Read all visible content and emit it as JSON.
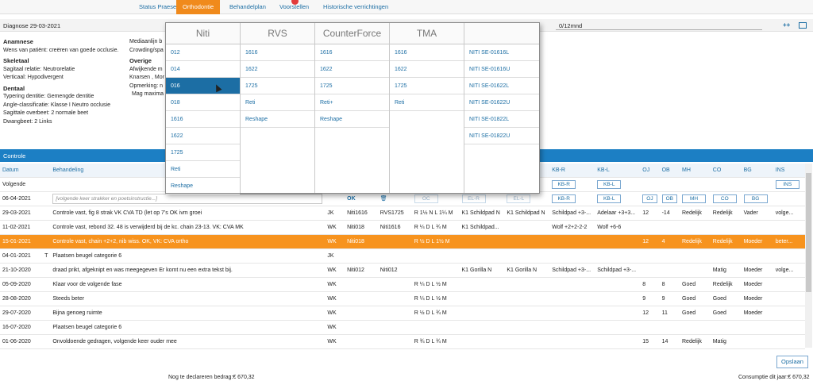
{
  "nav": {
    "tabs": [
      {
        "label": "Status Praesens"
      },
      {
        "label": "Orthodontie"
      },
      {
        "label": "Behandelplan"
      },
      {
        "label": "Voorstellen"
      },
      {
        "label": "Historische verrichtingen"
      }
    ]
  },
  "diagnosis": {
    "title": "Diagnose 29-03-2021",
    "months": "0/12mnd",
    "plus": "++"
  },
  "anamnese": {
    "heading": "Anamnese",
    "text": "Wens van patiënt: creëren van goede occlusie."
  },
  "skeletaal": {
    "heading": "Skeletaal",
    "lines": [
      "Sagitaal relatie: Neutrorelatie",
      "Verticaal: Hypodivergent"
    ]
  },
  "dentaal": {
    "heading": "Dentaal",
    "lines": [
      "Typering dentitie: Gemengde dentitie",
      "Angle-classificatie: Klasse I Neutro occlusie",
      "Sagittale overbeet: 2 normale beet",
      "Dwangbeet: 2 Links"
    ]
  },
  "middle_panel": {
    "lines": [
      "Mediaanlijn b",
      "Crowding/spa"
    ],
    "overige_heading": "Overige",
    "overige_lines": [
      "Afwijkende m",
      "Knarsen , Mor",
      "Opmerking: n",
      "Mag maxima"
    ]
  },
  "controle": {
    "title": "Controle",
    "columns": [
      "Datum",
      "Behandeling",
      "",
      "",
      "",
      "",
      "",
      "",
      "",
      "KB-R",
      "KB-L",
      "OJ",
      "OB",
      "MH",
      "CO",
      "BG",
      "INS"
    ],
    "volgende_label": "Volgende",
    "volgende_chips": [
      "KB-R",
      "KB-L",
      "INS"
    ],
    "input_row": {
      "date": "06-04-2021",
      "placeholder": "[volgende keer strakker en poetsinstructie...]",
      "ok": "OK",
      "chips": [
        "OC",
        "EL-R",
        "EL-L",
        "KB-R",
        "KB-L",
        "OJ",
        "OB",
        "MH",
        "CO",
        "BG"
      ]
    },
    "rows": [
      {
        "date": "29-03-2021",
        "t": "",
        "text": "Controle vast, fig 8 strak  VK CVA TD (let op 7's OK ivm groei",
        "by": "JK",
        "b1": "Niti1616",
        "b2": "RVS1725",
        "elastic": "R 1½ N L 1¼ M",
        "kbr": "K1 Schildpad N",
        "kbl": "K1 Schildpad N",
        "x1": "Schildpad +3-...",
        "x2": "Adelaar +3+3...",
        "oj": "12",
        "ob": "-14",
        "mh": "Redelijk",
        "co": "Redelijk",
        "bg": "Vader",
        "ins": "volge..."
      },
      {
        "date": "11-02-2021",
        "t": "",
        "text": "Controle vast, rebond 32.  48 is verwijderd bij de kc. chain 23-13. VK: CVA MK",
        "by": "WK",
        "b1": "Niti018",
        "b2": "Niti1616",
        "elastic": "R ¼ D L ¾ M",
        "kbr": "K1 Schildpad...",
        "kbl": "",
        "x1": "Wolf +2+2-2-2",
        "x2": "Wolf +6-6",
        "oj": "",
        "ob": "",
        "mh": "",
        "co": "",
        "bg": "",
        "ins": ""
      },
      {
        "date": "15-01-2021",
        "t": "",
        "text": "Controle vast, chain +2+2, nib wiss. OK,  VK: CVA ortho",
        "by": "WK",
        "b1": "Niti018",
        "b2": "",
        "elastic": "R ½ D L 1½ M",
        "kbr": "",
        "kbl": "",
        "x1": "",
        "x2": "",
        "oj": "12",
        "ob": "4",
        "mh": "Redelijk",
        "co": "Redelijk",
        "bg": "Moeder",
        "ins": "beter..."
      },
      {
        "date": "04-01-2021",
        "t": "T",
        "text": "Plaatsen beugel categorie 6",
        "by": "JK",
        "b1": "",
        "b2": "",
        "elastic": "",
        "kbr": "",
        "kbl": "",
        "x1": "",
        "x2": "",
        "oj": "",
        "ob": "",
        "mh": "",
        "co": "",
        "bg": "",
        "ins": ""
      },
      {
        "date": "21-10-2020",
        "t": "",
        "text": "draad prikt, afgeknipt en was meegegeven Er komt nu een extra  tekst bij.",
        "by": "WK",
        "b1": "Niti012",
        "b2": "Niti012",
        "elastic": "",
        "kbr": "K1 Gorilla N",
        "kbl": "K1 Gorilla N",
        "x1": "Schildpad +3-...",
        "x2": "Schildpad +3-...",
        "oj": "",
        "ob": "",
        "mh": "",
        "co": "Matig",
        "bg": "Moeder",
        "ins": "volge..."
      },
      {
        "date": "05-09-2020",
        "t": "",
        "text": "Klaar voor de volgende fase",
        "by": "WK",
        "b1": "",
        "b2": "",
        "elastic": "R ¼ D L ½ M",
        "kbr": "",
        "kbl": "",
        "x1": "",
        "x2": "",
        "oj": "8",
        "ob": "8",
        "mh": "Goed",
        "co": "Redelijk",
        "bg": "Moeder",
        "ins": ""
      },
      {
        "date": "28-08-2020",
        "t": "",
        "text": "Steeds beter",
        "by": "WK",
        "b1": "",
        "b2": "",
        "elastic": "R ¼ D L ½ M",
        "kbr": "",
        "kbl": "",
        "x1": "",
        "x2": "",
        "oj": "9",
        "ob": "9",
        "mh": "Goed",
        "co": "Goed",
        "bg": "Moeder",
        "ins": ""
      },
      {
        "date": "29-07-2020",
        "t": "",
        "text": "Bijna genoeg ruimte",
        "by": "WK",
        "b1": "",
        "b2": "",
        "elastic": "R ½ D L ¾ M",
        "kbr": "",
        "kbl": "",
        "x1": "",
        "x2": "",
        "oj": "12",
        "ob": "11",
        "mh": "Goed",
        "co": "Goed",
        "bg": "Moeder",
        "ins": ""
      },
      {
        "date": "16-07-2020",
        "t": "",
        "text": "Plaatsen beugel categorie 6",
        "by": "WK",
        "b1": "",
        "b2": "",
        "elastic": "",
        "kbr": "",
        "kbl": "",
        "x1": "",
        "x2": "",
        "oj": "",
        "ob": "",
        "mh": "",
        "co": "",
        "bg": "",
        "ins": ""
      },
      {
        "date": "01-06-2020",
        "t": "",
        "text": "Onvoldoende gedragen, volgende keer ouder mee",
        "by": "WK",
        "b1": "",
        "b2": "",
        "elastic": "R ¾ D L ¾ M",
        "kbr": "",
        "kbl": "",
        "x1": "",
        "x2": "",
        "oj": "15",
        "ob": "14",
        "mh": "Redelijk",
        "co": "Matig",
        "bg": "",
        "ins": ""
      }
    ],
    "save": "Opslaan"
  },
  "footer": {
    "left": "Nog te declareren bedrag:€ 670,32",
    "right": "Consumptie dit jaar:€ 670,32"
  },
  "wire_popup": {
    "columns": [
      {
        "header": "Niti",
        "items": [
          "012",
          "014",
          "016",
          "018",
          "1616",
          "1622",
          "1725",
          "Reti",
          "Reshape"
        ],
        "active_index": 2
      },
      {
        "header": "RVS",
        "items": [
          "1616",
          "1622",
          "1725",
          "Reti",
          "Reshape"
        ]
      },
      {
        "header": "CounterForce",
        "items": [
          "1616",
          "1622",
          "1725",
          "Reti+",
          "Reshape"
        ]
      },
      {
        "header": "TMA",
        "items": [
          "1616",
          "1622",
          "1725",
          "Reti"
        ]
      },
      {
        "header": "",
        "items": [
          "NITI SE-01616L",
          "NITI SE-01616U",
          "NITI SE-01622L",
          "NITI SE-01622U",
          "NITI SE-01822L",
          "NITI SE-01822U"
        ]
      }
    ]
  }
}
